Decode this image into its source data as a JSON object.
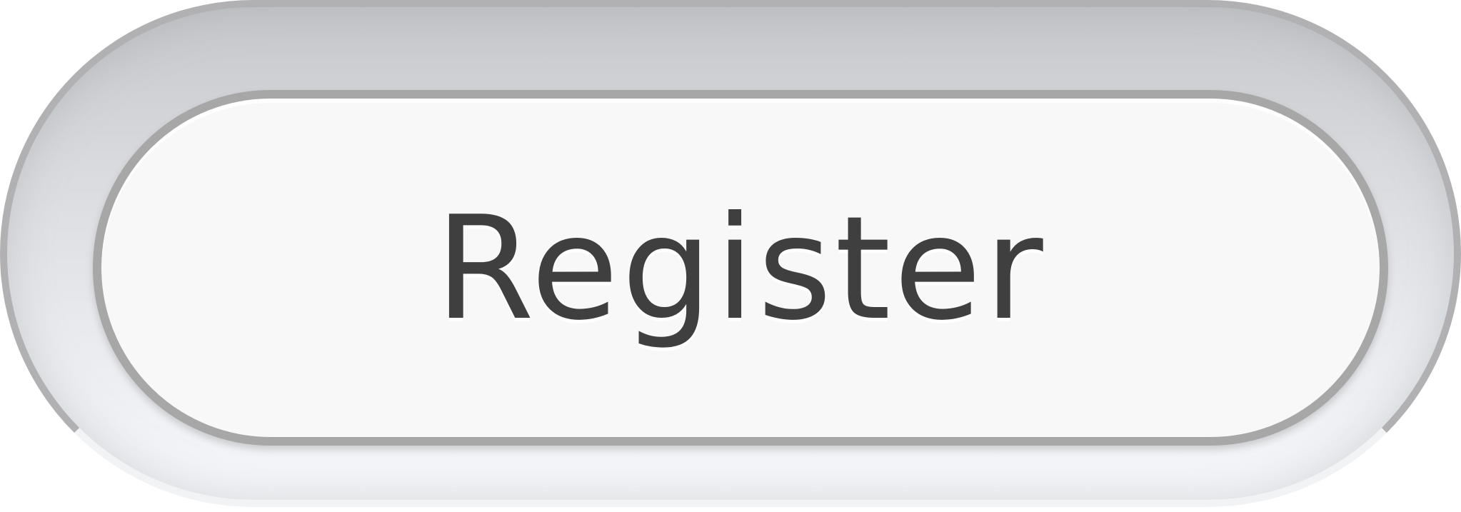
{
  "button": {
    "label": "Register"
  },
  "colors": {
    "text": "#3f3f3f",
    "inner_fill": "#f8f8f8",
    "inner_border": "#a7a7a7",
    "outer_border": "#b1b1b3"
  }
}
